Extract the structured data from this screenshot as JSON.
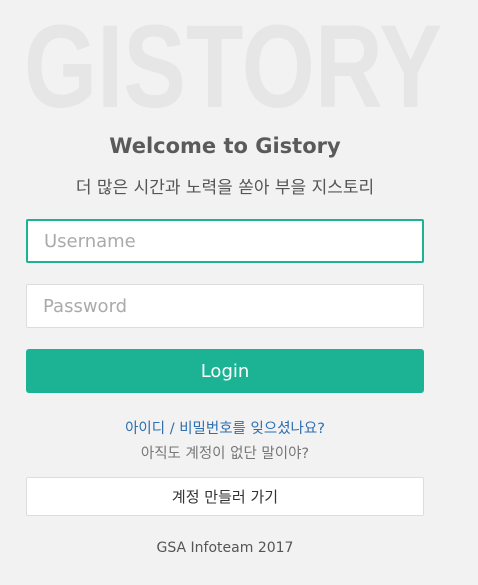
{
  "logo": {
    "text": "GISTORY",
    "color": "#e6e6e6"
  },
  "header": {
    "title": "Welcome to Gistory",
    "subtitle": "더 많은 시간과 노력을 쏟아 부을 지스토리"
  },
  "form": {
    "username_placeholder": "Username",
    "username_value": "",
    "password_placeholder": "Password",
    "password_value": "",
    "login_label": "Login"
  },
  "links": {
    "forgot": "아이디 / 비밀번호를 잊으셨나요?",
    "no_account": "아직도 계정이 없단 말이야?",
    "signup_label": "계정 만들러 가기"
  },
  "footer": {
    "text": "GSA Infoteam 2017"
  },
  "colors": {
    "accent": "#1bb394",
    "link": "#2e6fb0",
    "background": "#f2f2f2"
  }
}
